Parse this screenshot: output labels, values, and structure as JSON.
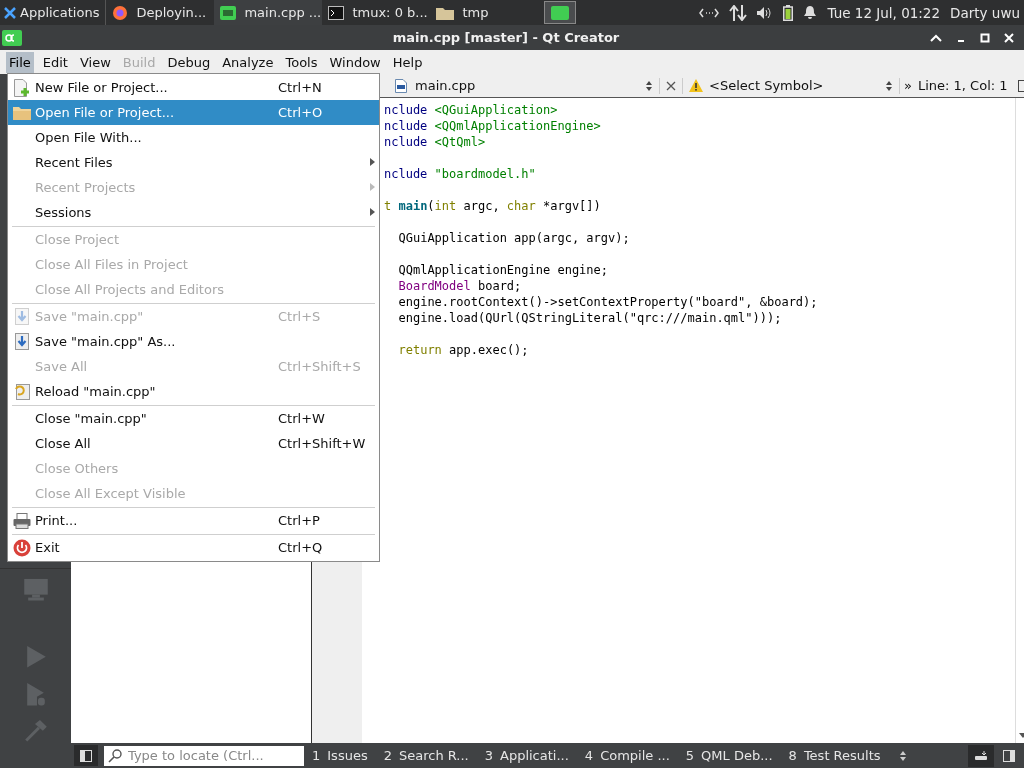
{
  "taskbar": {
    "apps_label": "Applications",
    "tasks": [
      {
        "label": "Deployin...",
        "kind": "browser",
        "selected": false
      },
      {
        "label": "main.cpp ...",
        "kind": "ide",
        "selected": true
      },
      {
        "label": "tmux: 0 b...",
        "kind": "terminal",
        "selected": false
      },
      {
        "label": "tmp",
        "kind": "folder",
        "selected": false
      }
    ],
    "clock": "Tue 12 Jul, 01:22",
    "user": "Darty uwu"
  },
  "window": {
    "title": "main.cpp [master] - Qt Creator"
  },
  "menubar": [
    {
      "label": "File",
      "selected": true,
      "disabled": false
    },
    {
      "label": "Edit",
      "selected": false,
      "disabled": false
    },
    {
      "label": "View",
      "selected": false,
      "disabled": false
    },
    {
      "label": "Build",
      "selected": false,
      "disabled": true
    },
    {
      "label": "Debug",
      "selected": false,
      "disabled": false
    },
    {
      "label": "Analyze",
      "selected": false,
      "disabled": false
    },
    {
      "label": "Tools",
      "selected": false,
      "disabled": false
    },
    {
      "label": "Window",
      "selected": false,
      "disabled": false
    },
    {
      "label": "Help",
      "selected": false,
      "disabled": false
    }
  ],
  "file_menu": [
    [
      {
        "label": "New File or Project...",
        "shortcut": "Ctrl+N",
        "kind": "new",
        "disabled": false,
        "selected": false,
        "submenu": false
      },
      {
        "label": "Open File or Project...",
        "shortcut": "Ctrl+O",
        "kind": "open",
        "disabled": false,
        "selected": true,
        "submenu": false
      },
      {
        "label": "Open File With...",
        "disabled": false,
        "selected": false,
        "submenu": false
      },
      {
        "label": "Recent Files",
        "disabled": false,
        "selected": false,
        "submenu": true
      },
      {
        "label": "Recent Projects",
        "disabled": true,
        "selected": false,
        "submenu": true
      },
      {
        "label": "Sessions",
        "disabled": false,
        "selected": false,
        "submenu": true
      }
    ],
    [
      {
        "label": "Close Project",
        "disabled": true,
        "selected": false,
        "submenu": false
      },
      {
        "label": "Close All Files in Project",
        "disabled": true,
        "selected": false,
        "submenu": false
      },
      {
        "label": "Close All Projects and Editors",
        "disabled": true,
        "selected": false,
        "submenu": false
      }
    ],
    [
      {
        "label": "Save \"main.cpp\"",
        "shortcut": "Ctrl+S",
        "kind": "save",
        "disabled": true,
        "selected": false,
        "submenu": false
      },
      {
        "label": "Save \"main.cpp\" As...",
        "kind": "save",
        "disabled": false,
        "selected": false,
        "submenu": false
      },
      {
        "label": "Save All",
        "shortcut": "Ctrl+Shift+S",
        "disabled": true,
        "selected": false,
        "submenu": false
      },
      {
        "label": "Reload \"main.cpp\"",
        "kind": "reload",
        "disabled": false,
        "selected": false,
        "submenu": false
      }
    ],
    [
      {
        "label": "Close \"main.cpp\"",
        "shortcut": "Ctrl+W",
        "disabled": false,
        "selected": false,
        "submenu": false
      },
      {
        "label": "Close All",
        "shortcut": "Ctrl+Shift+W",
        "disabled": false,
        "selected": false,
        "submenu": false
      },
      {
        "label": "Close Others",
        "disabled": true,
        "selected": false,
        "submenu": false
      },
      {
        "label": "Close All Except Visible",
        "disabled": true,
        "selected": false,
        "submenu": false
      }
    ],
    [
      {
        "label": "Print...",
        "shortcut": "Ctrl+P",
        "kind": "print",
        "disabled": false,
        "selected": false,
        "submenu": false
      }
    ],
    [
      {
        "label": "Exit",
        "shortcut": "Ctrl+Q",
        "kind": "exit",
        "disabled": false,
        "selected": false,
        "submenu": false
      }
    ]
  ],
  "editor_toolbar": {
    "file": "main.cpp",
    "symbol": "<Select Symbol>",
    "more": "»",
    "position": "Line: 1, Col: 1"
  },
  "code": [
    {
      "kind": "code",
      "indented": false,
      "tokens": [
        {
          "text": "nclude ",
          "kind": "preproc"
        },
        {
          "text": "<QGuiApplication>",
          "kind": "string"
        }
      ]
    },
    {
      "kind": "code",
      "indented": false,
      "tokens": [
        {
          "text": "nclude ",
          "kind": "preproc"
        },
        {
          "text": "<QQmlApplicationEngine>",
          "kind": "string"
        }
      ]
    },
    {
      "kind": "code",
      "indented": false,
      "tokens": [
        {
          "text": "nclude ",
          "kind": "preproc"
        },
        {
          "text": "<QtQml>",
          "kind": "string"
        }
      ]
    },
    {
      "kind": "blank"
    },
    {
      "kind": "code",
      "indented": false,
      "tokens": [
        {
          "text": "nclude ",
          "kind": "preproc"
        },
        {
          "text": "\"boardmodel.h\"",
          "kind": "string"
        }
      ]
    },
    {
      "kind": "blank"
    },
    {
      "kind": "code",
      "indented": false,
      "tokens": [
        {
          "text": "t ",
          "kind": "keyword"
        },
        {
          "text": "main",
          "kind": "function"
        },
        {
          "text": "(",
          "kind": "plain"
        },
        {
          "text": "int",
          "kind": "keyword"
        },
        {
          "text": " argc, ",
          "kind": "plain"
        },
        {
          "text": "char",
          "kind": "keyword"
        },
        {
          "text": " *argv[])",
          "kind": "plain"
        }
      ]
    },
    {
      "kind": "blank"
    },
    {
      "kind": "code",
      "indented": true,
      "tokens": [
        {
          "text": "QGuiApplication app(argc, argv);",
          "kind": "plain"
        }
      ]
    },
    {
      "kind": "blank"
    },
    {
      "kind": "code",
      "indented": true,
      "tokens": [
        {
          "text": "QQmlApplicationEngine engine;",
          "kind": "plain"
        }
      ]
    },
    {
      "kind": "code",
      "indented": true,
      "tokens": [
        {
          "text": "BoardModel",
          "kind": "type"
        },
        {
          "text": " board;",
          "kind": "plain"
        }
      ]
    },
    {
      "kind": "code",
      "indented": true,
      "tokens": [
        {
          "text": "engine.rootContext()->setContextProperty(\"board\", &board);",
          "kind": "plain"
        }
      ]
    },
    {
      "kind": "code",
      "indented": true,
      "tokens": [
        {
          "text": "engine.load(QUrl(QStringLiteral(\"qrc:///main.qml\")));",
          "kind": "plain"
        }
      ]
    },
    {
      "kind": "blank"
    },
    {
      "kind": "code",
      "indented": true,
      "tokens": [
        {
          "text": "return",
          "kind": "keyword"
        },
        {
          "text": " app.exec();",
          "kind": "plain"
        }
      ]
    }
  ],
  "status_bar": {
    "locate_placeholder": "Type to locate (Ctrl...",
    "panes": [
      {
        "number": "1",
        "label": "Issues"
      },
      {
        "number": "2",
        "label": "Search R..."
      },
      {
        "number": "3",
        "label": "Applicati..."
      },
      {
        "number": "4",
        "label": "Compile ..."
      },
      {
        "number": "5",
        "label": "QML Deb..."
      },
      {
        "number": "8",
        "label": "Test Results"
      }
    ]
  }
}
